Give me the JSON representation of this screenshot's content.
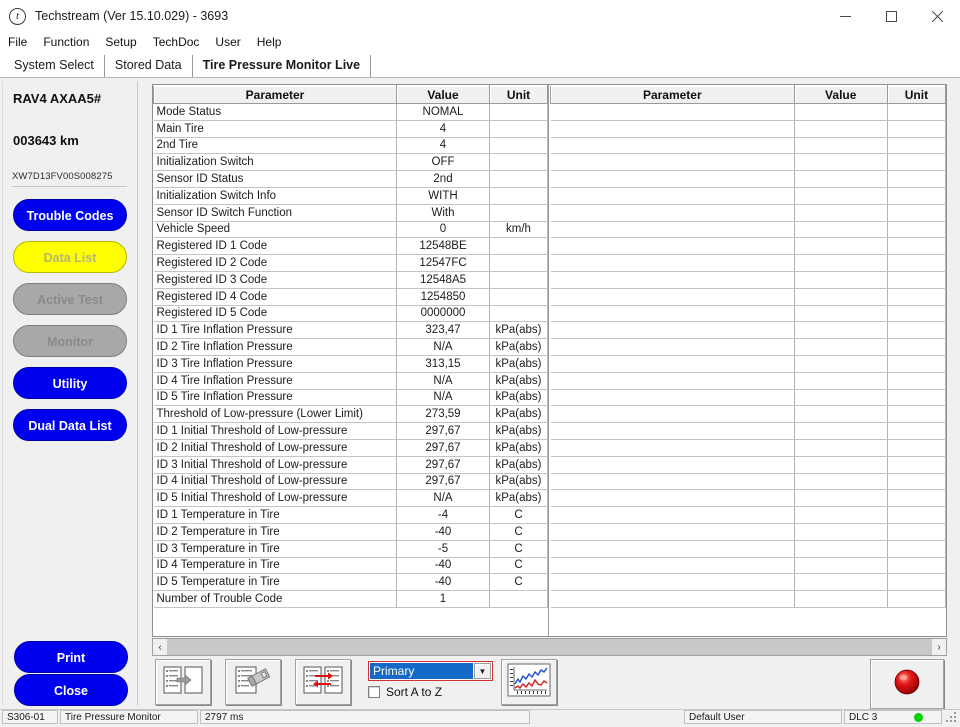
{
  "window": {
    "title": "Techstream (Ver 15.10.029) - 3693",
    "app_icon": "t",
    "minimize": "—",
    "maximize": "□",
    "close": "✕"
  },
  "menu": {
    "items": [
      {
        "label": "File"
      },
      {
        "label": "Function"
      },
      {
        "label": "Setup"
      },
      {
        "label": "TechDoc"
      },
      {
        "label": "User"
      },
      {
        "label": "Help"
      }
    ]
  },
  "tabs": [
    {
      "label": "System Select",
      "active": false
    },
    {
      "label": "Stored Data",
      "active": false
    },
    {
      "label": "Tire Pressure Monitor Live",
      "active": true
    }
  ],
  "sidebar": {
    "vehicle_model": "RAV4 AXAA5#",
    "odometer": "003643 km",
    "vin": "XW7D13FV00S008275",
    "buttons": [
      {
        "label": "Trouble Codes",
        "style": "blue",
        "enabled": true
      },
      {
        "label": "Data List",
        "style": "yellow",
        "enabled": true
      },
      {
        "label": "Active Test",
        "style": "grey",
        "enabled": false
      },
      {
        "label": "Monitor",
        "style": "grey",
        "enabled": false
      },
      {
        "label": "Utility",
        "style": "blue",
        "enabled": true
      },
      {
        "label": "Dual Data List",
        "style": "blue",
        "enabled": true
      }
    ],
    "print_label": "Print",
    "close_label": "Close"
  },
  "datalist": {
    "headers": {
      "parameter": "Parameter",
      "value": "Value",
      "unit": "Unit"
    },
    "left_rows": [
      {
        "parameter": "Mode Status",
        "value": "NOMAL",
        "unit": ""
      },
      {
        "parameter": "Main Tire",
        "value": "4",
        "unit": ""
      },
      {
        "parameter": "2nd Tire",
        "value": "4",
        "unit": ""
      },
      {
        "parameter": "Initialization Switch",
        "value": "OFF",
        "unit": ""
      },
      {
        "parameter": "Sensor ID Status",
        "value": "2nd",
        "unit": ""
      },
      {
        "parameter": "Initialization Switch Info",
        "value": "WITH",
        "unit": ""
      },
      {
        "parameter": "Sensor ID Switch Function",
        "value": "With",
        "unit": ""
      },
      {
        "parameter": "Vehicle Speed",
        "value": "0",
        "unit": "km/h"
      },
      {
        "parameter": "Registered ID 1 Code",
        "value": "12548BE",
        "unit": ""
      },
      {
        "parameter": "Registered ID 2 Code",
        "value": "12547FC",
        "unit": ""
      },
      {
        "parameter": "Registered ID 3 Code",
        "value": "12548A5",
        "unit": ""
      },
      {
        "parameter": "Registered ID 4 Code",
        "value": "1254850",
        "unit": ""
      },
      {
        "parameter": "Registered ID 5 Code",
        "value": "0000000",
        "unit": ""
      },
      {
        "parameter": "ID 1 Tire Inflation Pressure",
        "value": "323,47",
        "unit": "kPa(abs)"
      },
      {
        "parameter": "ID 2 Tire Inflation Pressure",
        "value": "N/A",
        "unit": "kPa(abs)"
      },
      {
        "parameter": "ID 3 Tire Inflation Pressure",
        "value": "313,15",
        "unit": "kPa(abs)"
      },
      {
        "parameter": "ID 4 Tire Inflation Pressure",
        "value": "N/A",
        "unit": "kPa(abs)"
      },
      {
        "parameter": "ID 5 Tire Inflation Pressure",
        "value": "N/A",
        "unit": "kPa(abs)"
      },
      {
        "parameter": "Threshold of Low-pressure (Lower Limit)",
        "value": "273,59",
        "unit": "kPa(abs)"
      },
      {
        "parameter": "ID 1 Initial Threshold of Low-pressure",
        "value": "297,67",
        "unit": "kPa(abs)"
      },
      {
        "parameter": "ID 2 Initial Threshold of Low-pressure",
        "value": "297,67",
        "unit": "kPa(abs)"
      },
      {
        "parameter": "ID 3 Initial Threshold of Low-pressure",
        "value": "297,67",
        "unit": "kPa(abs)"
      },
      {
        "parameter": "ID 4 Initial Threshold of Low-pressure",
        "value": "297,67",
        "unit": "kPa(abs)"
      },
      {
        "parameter": "ID 5 Initial Threshold of Low-pressure",
        "value": "N/A",
        "unit": "kPa(abs)"
      },
      {
        "parameter": "ID 1 Temperature in Tire",
        "value": "-4",
        "unit": "C"
      },
      {
        "parameter": "ID 2 Temperature in Tire",
        "value": "-40",
        "unit": "C"
      },
      {
        "parameter": "ID 3 Temperature in Tire",
        "value": "-5",
        "unit": "C"
      },
      {
        "parameter": "ID 4 Temperature in Tire",
        "value": "-40",
        "unit": "C"
      },
      {
        "parameter": "ID 5 Temperature in Tire",
        "value": "-40",
        "unit": "C"
      },
      {
        "parameter": "Number of Trouble Code",
        "value": "1",
        "unit": ""
      }
    ],
    "right_row_count": 30
  },
  "scrollbar": {
    "left_arrow": "‹",
    "right_arrow": "›"
  },
  "toolbar": {
    "buttons": [
      {
        "icon": "move-right-icon"
      },
      {
        "icon": "save-snapshot-icon"
      },
      {
        "icon": "swap-lists-icon"
      },
      {
        "icon": "graph-icon"
      }
    ],
    "dropdown": {
      "value": "Primary",
      "arrow": "▼"
    },
    "sort_label": "Sort A to Z",
    "sort_checked": false,
    "record_icon": "record-button-icon"
  },
  "statusbar": {
    "code": "S306-01",
    "system": "Tire Pressure Monitor",
    "timing": "2797 ms",
    "user": "Default User",
    "dlc": "DLC 3",
    "led_color": "#00d000"
  }
}
